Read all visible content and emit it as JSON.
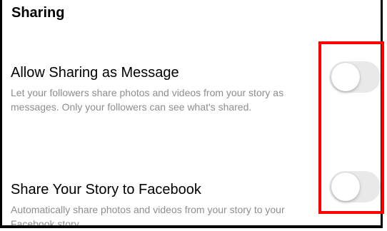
{
  "section": {
    "title": "Sharing"
  },
  "settings": [
    {
      "title": "Allow Sharing as Message",
      "description": "Let your followers share photos and videos from your story as messages. Only your followers can see what's shared.",
      "enabled": false
    },
    {
      "title": "Share Your Story to Facebook",
      "description": "Automatically share photos and videos from your story to your Facebook story.",
      "enabled": false
    }
  ],
  "colors": {
    "toggle_off": "#e9e9ea",
    "description_text": "#8e8e8e",
    "highlight": "#ff0000"
  }
}
